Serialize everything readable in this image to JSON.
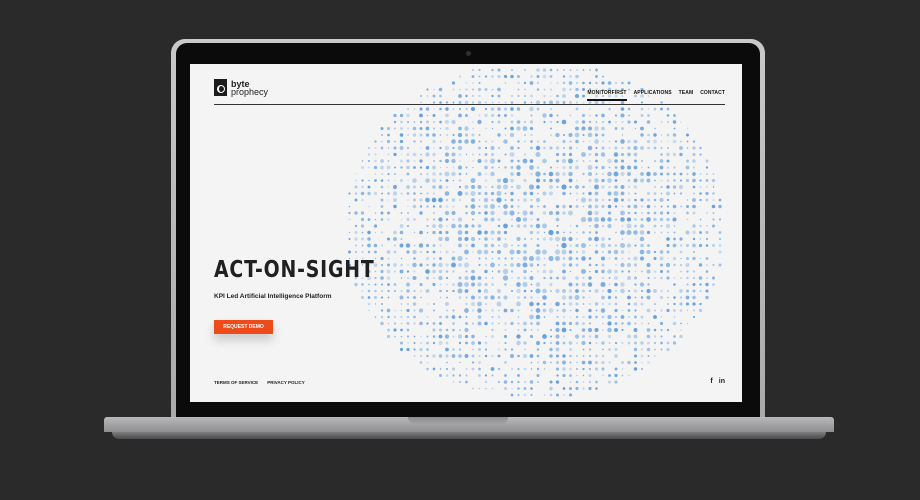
{
  "brand": {
    "logo_line1": "byte",
    "logo_line2": "prophecy",
    "accent": "#ef4a1a",
    "dot_color": "#4a90d9"
  },
  "nav": {
    "items": [
      "MONITORFIRST",
      "APPLICATIONS",
      "TEAM",
      "CONTACT"
    ],
    "active": "MONITORFIRST"
  },
  "hero": {
    "title": "ACT-ON-SIGHT",
    "subtitle": "KPI Led Artificial Intelligence Platform",
    "cta_label": "REQUEST DEMO"
  },
  "footer": {
    "terms": "TERMS OF SERVICE",
    "privacy": "PRIVACY POLICY",
    "facebook_glyph": "f",
    "linkedin_glyph": "in"
  }
}
